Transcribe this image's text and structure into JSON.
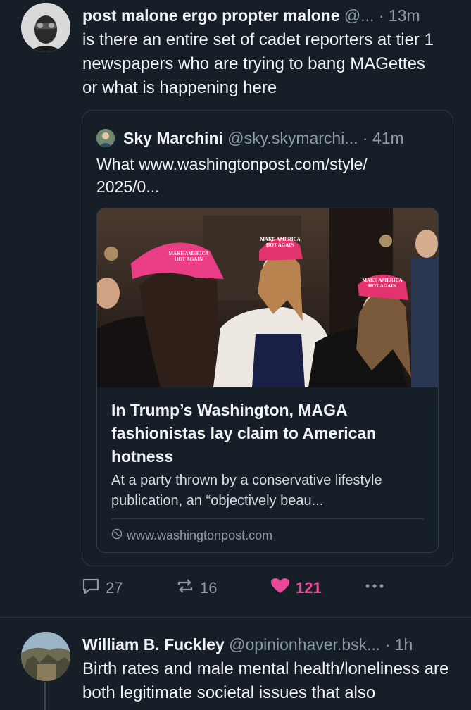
{
  "post1": {
    "author": "post malone ergo propter malone",
    "handle": "@...",
    "time": "· 13m",
    "text": "is there an entire set of cadet reporters at tier 1 newspapers who are trying to bang MAGettes or what is happening here",
    "quote": {
      "author": "Sky Marchini",
      "handle": "@sky.skymarchi...",
      "time": "· 41m",
      "text": "What www.washingtonpost.com/style/ 2025/0...",
      "embed": {
        "image_caps": [
          "MAKE AMERICA HOT AGAIN",
          "MAKE AMERICA HOT AGAIN",
          "MAKE AMERICA HOT AGAIN"
        ],
        "title": "In Trump’s Washington, MAGA fashionistas lay claim to American hotness",
        "description": "At a party thrown by a conservative lifestyle publication, an “objectively beau...",
        "domain": "www.washingtonpost.com"
      }
    },
    "actions": {
      "replies": "27",
      "reposts": "16",
      "likes": "121"
    }
  },
  "post2": {
    "author": "William B. Fuckley",
    "handle": "@opinionhaver.bsk...",
    "time": "· 1h",
    "text": "Birth rates and male mental health/loneliness are both legitimate societal issues that also"
  },
  "colors": {
    "background": "#161e27",
    "muted": "#8d9aa8",
    "like_pink": "#ec4899",
    "border": "#2c3845"
  }
}
